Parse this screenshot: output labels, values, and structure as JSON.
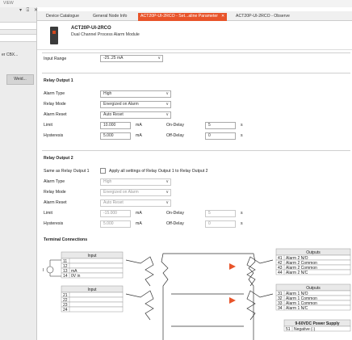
{
  "menubar": {
    "title": "VIEW"
  },
  "left_pane": {
    "controls": "▾ ⍐ ✕",
    "label": "er CBX...",
    "button": "Weid..."
  },
  "tabs": [
    {
      "label": "Device Catalogue"
    },
    {
      "label": "General Node Info"
    },
    {
      "label": "ACT20P-UI-2RCO - Set...aline Parameter",
      "close": "✕"
    },
    {
      "label": "ACT20P-UI-2RCO - Observe"
    }
  ],
  "device": {
    "name": "ACT20P-UI-2RCO",
    "description": "Dual Channel Process Alarm Module"
  },
  "input_range": {
    "label": "Input Range",
    "value": "-25..25 mA"
  },
  "relay1": {
    "title": "Relay Output 1",
    "alarm_type_label": "Alarm Type",
    "alarm_type": "High",
    "relay_mode_label": "Relay Mode",
    "relay_mode": "Energized on Alarm",
    "alarm_reset_label": "Alarm Reset",
    "alarm_reset": "Auto Reset",
    "limit_label": "Limit",
    "limit": "10.000",
    "limit_unit": "mA",
    "on_delay_label": "On-Delay",
    "on_delay": "5",
    "on_delay_unit": "s",
    "hysteresis_label": "Hysteresis",
    "hysteresis": "5.000",
    "hysteresis_unit": "mA",
    "off_delay_label": "Off-Delay",
    "off_delay": "0",
    "off_delay_unit": "s"
  },
  "relay2": {
    "title": "Relay Output 2",
    "same_as_label": "Same as Relay Output 1",
    "apply_all_label": "Apply all settings of Relay Output 1 to Relay Output 2",
    "alarm_type_label": "Alarm Type",
    "alarm_type": "High",
    "relay_mode_label": "Relay Mode",
    "relay_mode": "Energized on Alarm",
    "alarm_reset_label": "Alarm Reset",
    "alarm_reset": "Auto Reset",
    "limit_label": "Limit",
    "limit": "-15.000",
    "limit_unit": "mA",
    "on_delay_label": "On-Delay",
    "on_delay": "5",
    "on_delay_unit": "s",
    "hysteresis_label": "Hysteresis",
    "hysteresis": "5.000",
    "hysteresis_unit": "mA",
    "off_delay_label": "Off-Delay",
    "off_delay": "0",
    "off_delay_unit": "s"
  },
  "terminal": {
    "title": "Terminal Connections",
    "input_top": {
      "header": "Input",
      "rows": [
        {
          "num": "11",
          "text": ""
        },
        {
          "num": "12",
          "text": ""
        },
        {
          "num": "13",
          "text": "mA"
        },
        {
          "num": "14",
          "text": "0V in"
        }
      ]
    },
    "input_bottom": {
      "header": "Input",
      "rows": [
        {
          "num": "21",
          "text": ""
        },
        {
          "num": "22",
          "text": ""
        },
        {
          "num": "23",
          "text": ""
        },
        {
          "num": "24",
          "text": ""
        }
      ]
    },
    "outputs_top": {
      "header": "Outputs",
      "rows": [
        {
          "num": "41",
          "text": "Alarm 2 N/O"
        },
        {
          "num": "42",
          "text": "Alarm 2 Common"
        },
        {
          "num": "43",
          "text": "Alarm 2 Common"
        },
        {
          "num": "44",
          "text": "Alarm 2 N/C"
        }
      ]
    },
    "outputs_bottom": {
      "header": "Outputs",
      "rows": [
        {
          "num": "31",
          "text": "Alarm 1 N/O"
        },
        {
          "num": "32",
          "text": "Alarm 1 Common"
        },
        {
          "num": "33",
          "text": "Alarm 1 Common"
        },
        {
          "num": "34",
          "text": "Alarm 1 N/C"
        }
      ]
    },
    "power": {
      "header": "9-60VDC Power Supply",
      "row_num": "51",
      "row_text": "Negative (-)"
    },
    "source_symbol": "I"
  }
}
